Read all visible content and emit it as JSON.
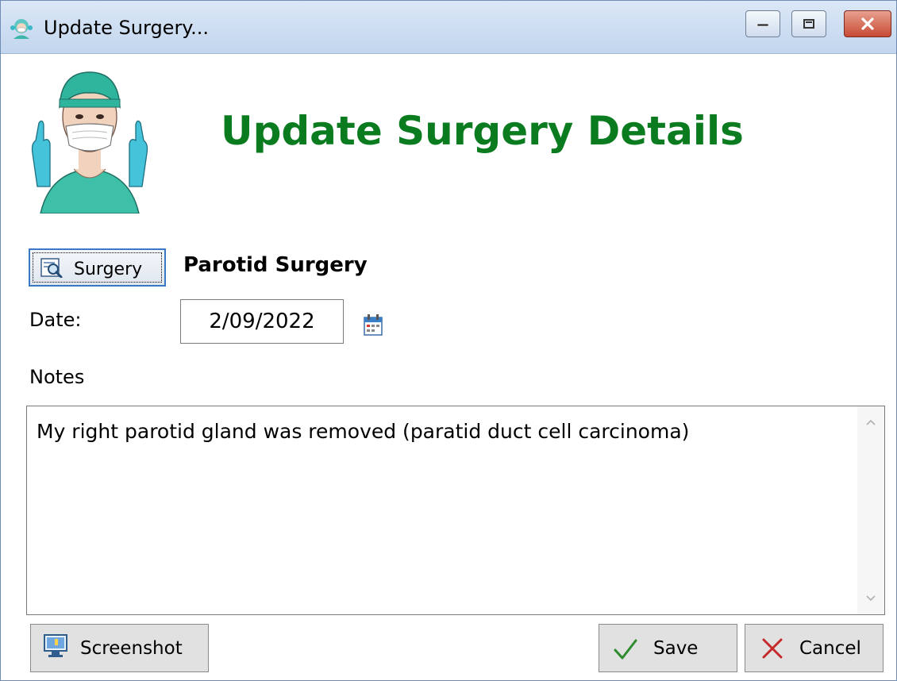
{
  "window": {
    "title": "Update Surgery...",
    "controls": [
      "minimize-icon",
      "maximize-icon",
      "close-icon"
    ],
    "app_icon": "surgeon-icon"
  },
  "header": {
    "title": "Update Surgery Details",
    "title_color": "#0a7b1f",
    "image": "surgeon-illustration"
  },
  "surgery": {
    "button_label": "Surgery",
    "button_icon": "search-record-icon",
    "name": "Parotid Surgery"
  },
  "date": {
    "label": "Date:",
    "value": "2/09/2022",
    "picker_icon": "calendar-icon"
  },
  "notes": {
    "label": "Notes",
    "value": "My right parotid gland was removed (paratid duct cell carcinoma)"
  },
  "footer": {
    "screenshot_label": "Screenshot",
    "screenshot_icon": "monitor-icon",
    "save_label": "Save",
    "save_icon": "checkmark-icon",
    "cancel_label": "Cancel",
    "cancel_icon": "x-icon"
  }
}
